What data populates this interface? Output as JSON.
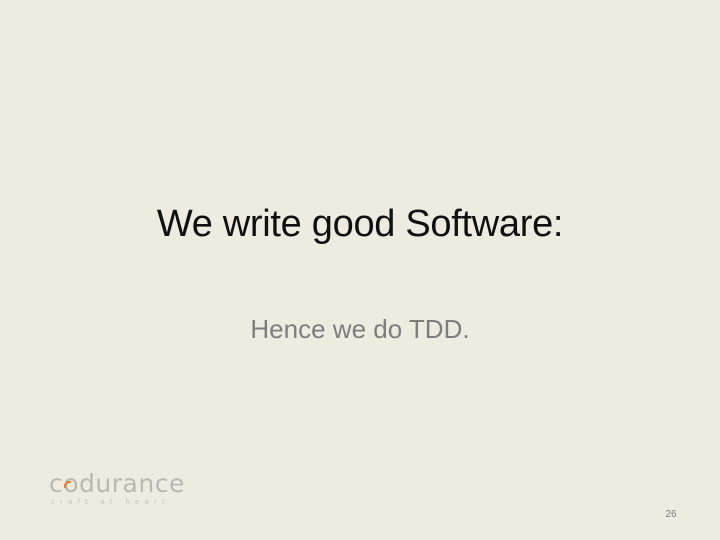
{
  "slide": {
    "title": "We write good Software:",
    "subtitle": "Hence we do TDD.",
    "page_number": "26"
  },
  "logo": {
    "wordmark": "codurance",
    "tagline": "craft at heart",
    "accent_color": "#e0813a"
  },
  "colors": {
    "background": "#eeebe0",
    "title": "#111111",
    "subtitle": "#7e7e7e"
  }
}
